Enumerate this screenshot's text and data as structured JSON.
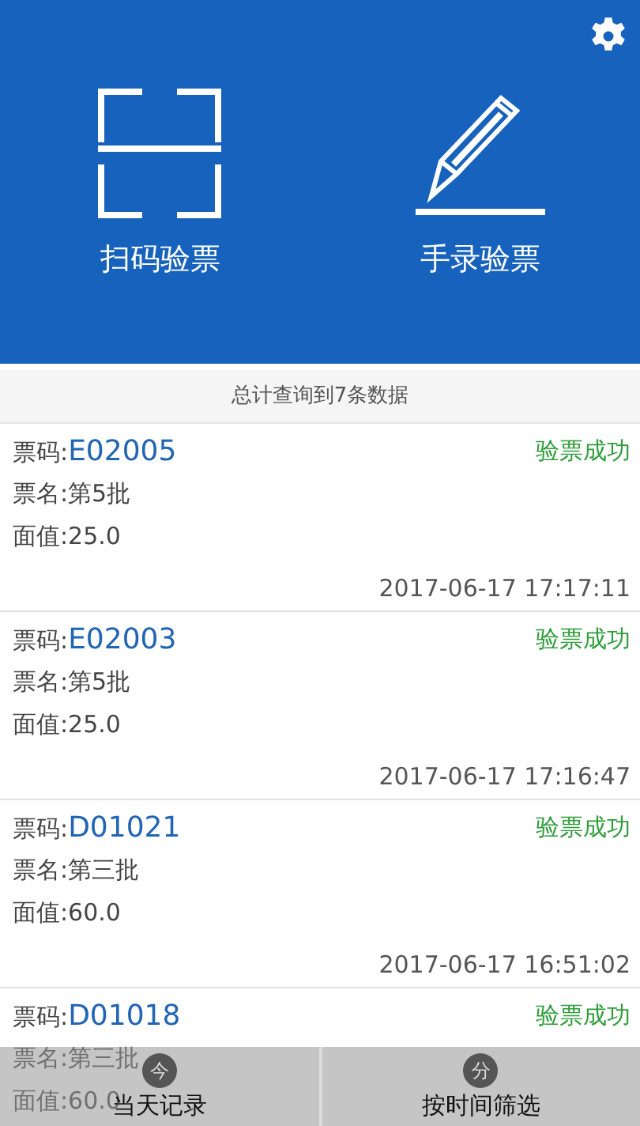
{
  "header": {
    "actions": [
      {
        "kind": "scan",
        "label": "扫码验票"
      },
      {
        "kind": "manual",
        "label": "手录验票"
      }
    ]
  },
  "summary": "总计查询到7条数据",
  "records": [
    {
      "code_label": "票码:",
      "code": "E02005",
      "name": "票名:第5批",
      "value": "面值:25.0",
      "status": "验票成功",
      "time": "2017-06-17 17:17:11"
    },
    {
      "code_label": "票码:",
      "code": "E02003",
      "name": "票名:第5批",
      "value": "面值:25.0",
      "status": "验票成功",
      "time": "2017-06-17 17:16:47"
    },
    {
      "code_label": "票码:",
      "code": "D01021",
      "name": "票名:第三批",
      "value": "面值:60.0",
      "status": "验票成功",
      "time": "2017-06-17 16:51:02"
    },
    {
      "code_label": "票码:",
      "code": "D01018",
      "name": "票名:第三批",
      "value": "面值:60.0",
      "status": "验票成功"
    }
  ],
  "bottom_bar": [
    {
      "glyph": "今",
      "label": "当天记录"
    },
    {
      "glyph": "分",
      "label": "按时间筛选"
    }
  ]
}
